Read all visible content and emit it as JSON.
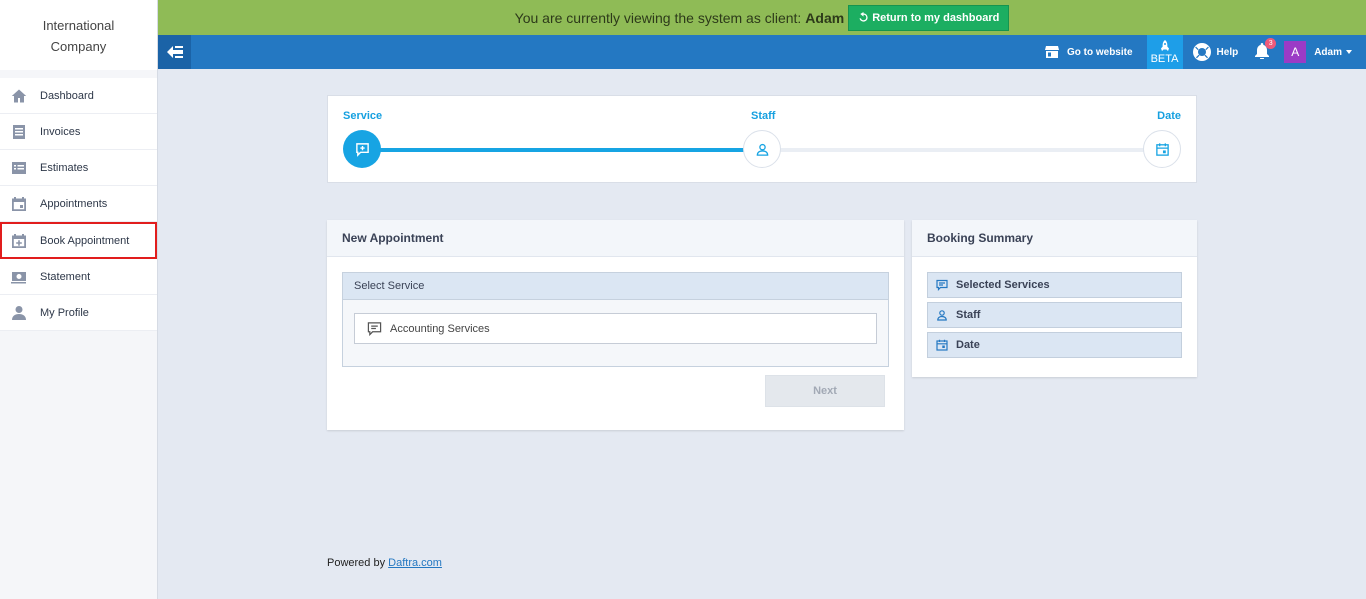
{
  "brand": {
    "line1": "International",
    "line2": "Company"
  },
  "sidebar": {
    "items": [
      {
        "label": "Dashboard",
        "icon": "home-icon"
      },
      {
        "label": "Invoices",
        "icon": "invoice-icon"
      },
      {
        "label": "Estimates",
        "icon": "estimate-icon"
      },
      {
        "label": "Appointments",
        "icon": "calendar-icon"
      },
      {
        "label": "Book Appointment",
        "icon": "calendar-add-icon",
        "active": true
      },
      {
        "label": "Statement",
        "icon": "money-icon"
      },
      {
        "label": "My Profile",
        "icon": "user-icon"
      }
    ]
  },
  "banner": {
    "text": "You are currently viewing the system as client:",
    "client": "Adam",
    "return_label": "Return to my dashboard"
  },
  "header": {
    "website_label": "Go to website",
    "beta_label": "BETA",
    "help_label": "Help",
    "notifications": "3",
    "avatar_letter": "A",
    "user_name": "Adam"
  },
  "stepper": {
    "steps": [
      "Service",
      "Staff",
      "Date"
    ],
    "active": 0
  },
  "new_appointment": {
    "title": "New Appointment",
    "select_title": "Select Service",
    "services": [
      "Accounting Services"
    ],
    "next_label": "Next"
  },
  "summary": {
    "title": "Booking Summary",
    "rows": [
      "Selected Services",
      "Staff",
      "Date"
    ]
  },
  "footer": {
    "prefix": "Powered by",
    "link": "Daftra.com"
  },
  "colors": {
    "banner": "#8fbb56",
    "header": "#2478c2",
    "accent": "#17a4e3",
    "return_button": "#1cae61",
    "active_border": "#e11d1d",
    "avatar": "#9b3bc6"
  }
}
